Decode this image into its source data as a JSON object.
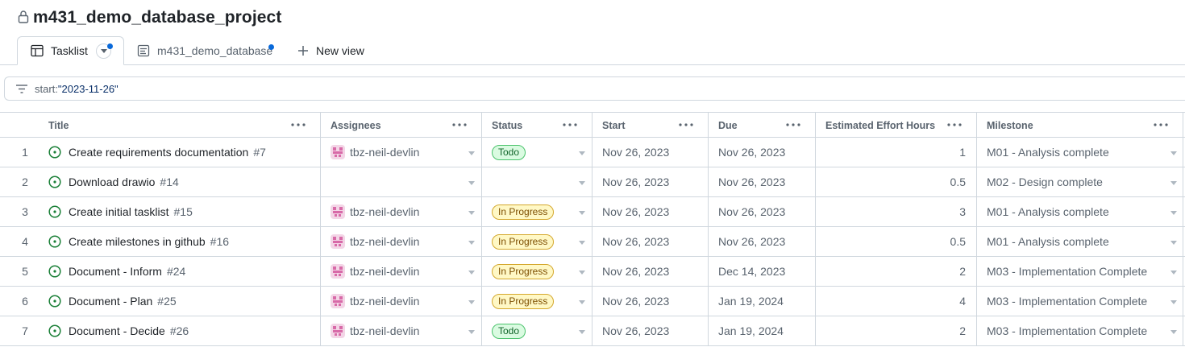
{
  "project": {
    "title": "m431_demo_database_project"
  },
  "tabs": [
    {
      "label": "Tasklist"
    },
    {
      "label": "m431_demo_database"
    },
    {
      "label": "New view"
    }
  ],
  "filter": {
    "key": "start:",
    "value": "\"2023-11-26\""
  },
  "columns": [
    "Title",
    "Assignees",
    "Status",
    "Start",
    "Due",
    "Estimated Effort Hours",
    "Milestone"
  ],
  "rows": [
    {
      "n": "1",
      "title": "Create requirements documentation",
      "issue": "#7",
      "assignee": "tbz-neil-devlin",
      "status": "Todo",
      "start": "Nov 26, 2023",
      "due": "Nov 26, 2023",
      "effort": "1",
      "milestone": "M01 - Analysis complete"
    },
    {
      "n": "2",
      "title": "Download drawio",
      "issue": "#14",
      "assignee": "",
      "status": "",
      "start": "Nov 26, 2023",
      "due": "Nov 26, 2023",
      "effort": "0.5",
      "milestone": "M02 - Design complete"
    },
    {
      "n": "3",
      "title": "Create initial tasklist",
      "issue": "#15",
      "assignee": "tbz-neil-devlin",
      "status": "In Progress",
      "start": "Nov 26, 2023",
      "due": "Nov 26, 2023",
      "effort": "3",
      "milestone": "M01 - Analysis complete"
    },
    {
      "n": "4",
      "title": "Create milestones in github",
      "issue": "#16",
      "assignee": "tbz-neil-devlin",
      "status": "In Progress",
      "start": "Nov 26, 2023",
      "due": "Nov 26, 2023",
      "effort": "0.5",
      "milestone": "M01 - Analysis complete"
    },
    {
      "n": "5",
      "title": "Document - Inform",
      "issue": "#24",
      "assignee": "tbz-neil-devlin",
      "status": "In Progress",
      "start": "Nov 26, 2023",
      "due": "Dec 14, 2023",
      "effort": "2",
      "milestone": "M03 - Implementation Complete"
    },
    {
      "n": "6",
      "title": "Document - Plan",
      "issue": "#25",
      "assignee": "tbz-neil-devlin",
      "status": "In Progress",
      "start": "Nov 26, 2023",
      "due": "Jan 19, 2024",
      "effort": "4",
      "milestone": "M03 - Implementation Complete"
    },
    {
      "n": "7",
      "title": "Document - Decide",
      "issue": "#26",
      "assignee": "tbz-neil-devlin",
      "status": "Todo",
      "start": "Nov 26, 2023",
      "due": "Jan 19, 2024",
      "effort": "2",
      "milestone": "M03 - Implementation Complete"
    }
  ],
  "colors": {
    "open_issue": "#1a7f37",
    "accent": "#0969da",
    "border": "#d0d7de"
  }
}
